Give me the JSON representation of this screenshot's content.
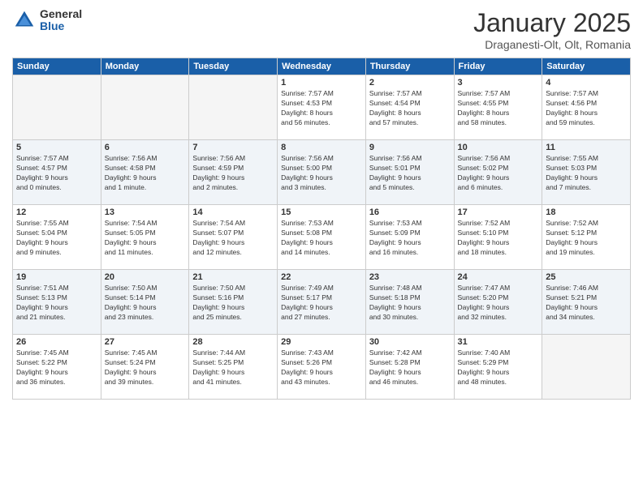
{
  "logo": {
    "general": "General",
    "blue": "Blue"
  },
  "header": {
    "month": "January 2025",
    "location": "Draganesti-Olt, Olt, Romania"
  },
  "weekdays": [
    "Sunday",
    "Monday",
    "Tuesday",
    "Wednesday",
    "Thursday",
    "Friday",
    "Saturday"
  ],
  "weeks": [
    [
      {
        "day": "",
        "info": ""
      },
      {
        "day": "",
        "info": ""
      },
      {
        "day": "",
        "info": ""
      },
      {
        "day": "1",
        "info": "Sunrise: 7:57 AM\nSunset: 4:53 PM\nDaylight: 8 hours\nand 56 minutes."
      },
      {
        "day": "2",
        "info": "Sunrise: 7:57 AM\nSunset: 4:54 PM\nDaylight: 8 hours\nand 57 minutes."
      },
      {
        "day": "3",
        "info": "Sunrise: 7:57 AM\nSunset: 4:55 PM\nDaylight: 8 hours\nand 58 minutes."
      },
      {
        "day": "4",
        "info": "Sunrise: 7:57 AM\nSunset: 4:56 PM\nDaylight: 8 hours\nand 59 minutes."
      }
    ],
    [
      {
        "day": "5",
        "info": "Sunrise: 7:57 AM\nSunset: 4:57 PM\nDaylight: 9 hours\nand 0 minutes."
      },
      {
        "day": "6",
        "info": "Sunrise: 7:56 AM\nSunset: 4:58 PM\nDaylight: 9 hours\nand 1 minute."
      },
      {
        "day": "7",
        "info": "Sunrise: 7:56 AM\nSunset: 4:59 PM\nDaylight: 9 hours\nand 2 minutes."
      },
      {
        "day": "8",
        "info": "Sunrise: 7:56 AM\nSunset: 5:00 PM\nDaylight: 9 hours\nand 3 minutes."
      },
      {
        "day": "9",
        "info": "Sunrise: 7:56 AM\nSunset: 5:01 PM\nDaylight: 9 hours\nand 5 minutes."
      },
      {
        "day": "10",
        "info": "Sunrise: 7:56 AM\nSunset: 5:02 PM\nDaylight: 9 hours\nand 6 minutes."
      },
      {
        "day": "11",
        "info": "Sunrise: 7:55 AM\nSunset: 5:03 PM\nDaylight: 9 hours\nand 7 minutes."
      }
    ],
    [
      {
        "day": "12",
        "info": "Sunrise: 7:55 AM\nSunset: 5:04 PM\nDaylight: 9 hours\nand 9 minutes."
      },
      {
        "day": "13",
        "info": "Sunrise: 7:54 AM\nSunset: 5:05 PM\nDaylight: 9 hours\nand 11 minutes."
      },
      {
        "day": "14",
        "info": "Sunrise: 7:54 AM\nSunset: 5:07 PM\nDaylight: 9 hours\nand 12 minutes."
      },
      {
        "day": "15",
        "info": "Sunrise: 7:53 AM\nSunset: 5:08 PM\nDaylight: 9 hours\nand 14 minutes."
      },
      {
        "day": "16",
        "info": "Sunrise: 7:53 AM\nSunset: 5:09 PM\nDaylight: 9 hours\nand 16 minutes."
      },
      {
        "day": "17",
        "info": "Sunrise: 7:52 AM\nSunset: 5:10 PM\nDaylight: 9 hours\nand 18 minutes."
      },
      {
        "day": "18",
        "info": "Sunrise: 7:52 AM\nSunset: 5:12 PM\nDaylight: 9 hours\nand 19 minutes."
      }
    ],
    [
      {
        "day": "19",
        "info": "Sunrise: 7:51 AM\nSunset: 5:13 PM\nDaylight: 9 hours\nand 21 minutes."
      },
      {
        "day": "20",
        "info": "Sunrise: 7:50 AM\nSunset: 5:14 PM\nDaylight: 9 hours\nand 23 minutes."
      },
      {
        "day": "21",
        "info": "Sunrise: 7:50 AM\nSunset: 5:16 PM\nDaylight: 9 hours\nand 25 minutes."
      },
      {
        "day": "22",
        "info": "Sunrise: 7:49 AM\nSunset: 5:17 PM\nDaylight: 9 hours\nand 27 minutes."
      },
      {
        "day": "23",
        "info": "Sunrise: 7:48 AM\nSunset: 5:18 PM\nDaylight: 9 hours\nand 30 minutes."
      },
      {
        "day": "24",
        "info": "Sunrise: 7:47 AM\nSunset: 5:20 PM\nDaylight: 9 hours\nand 32 minutes."
      },
      {
        "day": "25",
        "info": "Sunrise: 7:46 AM\nSunset: 5:21 PM\nDaylight: 9 hours\nand 34 minutes."
      }
    ],
    [
      {
        "day": "26",
        "info": "Sunrise: 7:45 AM\nSunset: 5:22 PM\nDaylight: 9 hours\nand 36 minutes."
      },
      {
        "day": "27",
        "info": "Sunrise: 7:45 AM\nSunset: 5:24 PM\nDaylight: 9 hours\nand 39 minutes."
      },
      {
        "day": "28",
        "info": "Sunrise: 7:44 AM\nSunset: 5:25 PM\nDaylight: 9 hours\nand 41 minutes."
      },
      {
        "day": "29",
        "info": "Sunrise: 7:43 AM\nSunset: 5:26 PM\nDaylight: 9 hours\nand 43 minutes."
      },
      {
        "day": "30",
        "info": "Sunrise: 7:42 AM\nSunset: 5:28 PM\nDaylight: 9 hours\nand 46 minutes."
      },
      {
        "day": "31",
        "info": "Sunrise: 7:40 AM\nSunset: 5:29 PM\nDaylight: 9 hours\nand 48 minutes."
      },
      {
        "day": "",
        "info": ""
      }
    ]
  ]
}
